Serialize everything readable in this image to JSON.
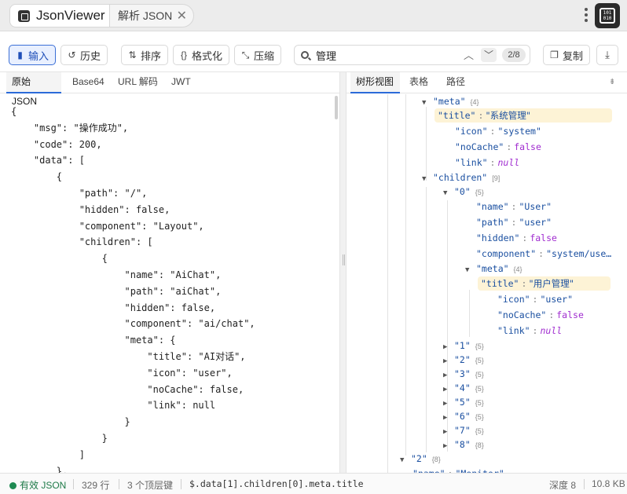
{
  "titlebar": {
    "app_name": "JsonViewer",
    "tab_label": "解析 JSON",
    "close": "✕"
  },
  "toolbar": {
    "input": "输入",
    "history": "历史",
    "sort": "排序",
    "format": "格式化",
    "compress": "压缩",
    "copy": "复制",
    "search_value": "管理",
    "search_count": "2/8"
  },
  "left_tabs": [
    "原始 JSON",
    "Base64",
    "URL 解码",
    "JWT"
  ],
  "right_tabs": [
    "树形视图",
    "表格",
    "路径"
  ],
  "code_lines": [
    "{",
    "    \"msg\": \"操作成功\",",
    "    \"code\": 200,",
    "    \"data\": [",
    "        {",
    "            \"path\": \"/\",",
    "            \"hidden\": false,",
    "            \"component\": \"Layout\",",
    "            \"children\": [",
    "                {",
    "                    \"name\": \"AiChat\",",
    "                    \"path\": \"aiChat\",",
    "                    \"hidden\": false,",
    "                    \"component\": \"ai/chat\",",
    "                    \"meta\": {",
    "                        \"title\": \"AI对话\",",
    "                        \"icon\": \"user\",",
    "                        \"noCache\": false,",
    "                        \"link\": null",
    "                    }",
    "                }",
    "            ]",
    "        },"
  ],
  "tree": [
    {
      "tw": "▼",
      "key": "\"meta\"",
      "count": "{4}"
    },
    {
      "key": "\"title\"",
      "val": "\"系统管理\"",
      "vt": "cn",
      "hl": true
    },
    {
      "key": "\"icon\"",
      "val": "\"system\"",
      "vt": "s"
    },
    {
      "key": "\"noCache\"",
      "val": "false",
      "vt": "b"
    },
    {
      "key": "\"link\"",
      "val": "null",
      "vt": "n"
    },
    {
      "tw": "▼",
      "key": "\"children\"",
      "count": "[9]"
    },
    {
      "tw": "▼",
      "key": "\"0\"",
      "count": "{5}"
    },
    {
      "key": "\"name\"",
      "val": "\"User\"",
      "vt": "s"
    },
    {
      "key": "\"path\"",
      "val": "\"user\"",
      "vt": "s"
    },
    {
      "key": "\"hidden\"",
      "val": "false",
      "vt": "b"
    },
    {
      "key": "\"component\"",
      "val": "\"system/use…",
      "vt": "s"
    },
    {
      "tw": "▼",
      "key": "\"meta\"",
      "count": "{4}"
    },
    {
      "key": "\"title\"",
      "val": "\"用户管理\"",
      "vt": "cn",
      "hl": true
    },
    {
      "key": "\"icon\"",
      "val": "\"user\"",
      "vt": "s"
    },
    {
      "key": "\"noCache\"",
      "val": "false",
      "vt": "b"
    },
    {
      "key": "\"link\"",
      "val": "null",
      "vt": "n"
    },
    {
      "tw": "▶",
      "key": "\"1\"",
      "count": "{5}"
    },
    {
      "tw": "▶",
      "key": "\"2\"",
      "count": "{5}"
    },
    {
      "tw": "▶",
      "key": "\"3\"",
      "count": "{5}"
    },
    {
      "tw": "▶",
      "key": "\"4\"",
      "count": "{5}"
    },
    {
      "tw": "▶",
      "key": "\"5\"",
      "count": "{5}"
    },
    {
      "tw": "▶",
      "key": "\"6\"",
      "count": "{5}"
    },
    {
      "tw": "▶",
      "key": "\"7\"",
      "count": "{5}"
    },
    {
      "tw": "▶",
      "key": "\"8\"",
      "count": "{8}"
    },
    {
      "tw": "▼",
      "key": "\"2\"",
      "count": "{8}"
    },
    {
      "key": "\"name\"",
      "val": "\"Monitor\"",
      "vt": "s"
    }
  ],
  "status": {
    "valid": "有效 JSON",
    "lines": "329 行",
    "top_keys": "3 个顶层键",
    "path": "$.data[1].children[0].meta.title",
    "depth": "深度 8",
    "size": "10.8 KB"
  }
}
